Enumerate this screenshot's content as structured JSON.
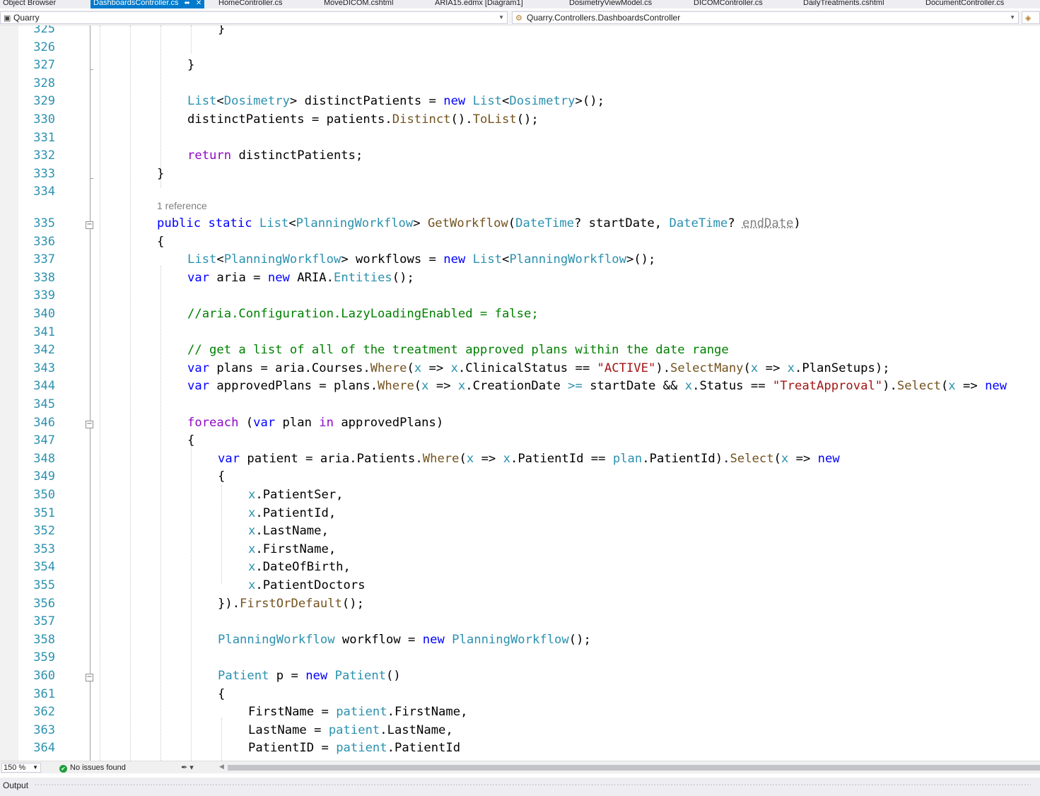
{
  "tabs": [
    {
      "label": "Object Browser",
      "active": false
    },
    {
      "label": "DashboardsController.cs",
      "active": true
    },
    {
      "label": "HomeController.cs",
      "active": false
    },
    {
      "label": "MoveDICOM.cshtml",
      "active": false
    },
    {
      "label": "ARIA15.edmx [Diagram1]",
      "active": false
    },
    {
      "label": "DosimetryViewModel.cs",
      "active": false
    },
    {
      "label": "DICOMController.cs",
      "active": false
    },
    {
      "label": "DailyTreatments.cshtml",
      "active": false
    },
    {
      "label": "DocumentController.cs",
      "active": false
    }
  ],
  "navbar": {
    "project": "Quarry",
    "type_path": "Quarry.Controllers.DashboardsController"
  },
  "editor": {
    "reference_hint": "1 reference",
    "lines": [
      {
        "n": "325"
      },
      {
        "n": "326"
      },
      {
        "n": "327"
      },
      {
        "n": "328"
      },
      {
        "n": "329"
      },
      {
        "n": "330"
      },
      {
        "n": "331"
      },
      {
        "n": "332"
      },
      {
        "n": "333"
      },
      {
        "n": "334"
      },
      {
        "n": "335"
      },
      {
        "n": "336"
      },
      {
        "n": "337"
      },
      {
        "n": "338"
      },
      {
        "n": "339"
      },
      {
        "n": "340"
      },
      {
        "n": "341"
      },
      {
        "n": "342"
      },
      {
        "n": "343"
      },
      {
        "n": "344"
      },
      {
        "n": "345"
      },
      {
        "n": "346"
      },
      {
        "n": "347"
      },
      {
        "n": "348"
      },
      {
        "n": "349"
      },
      {
        "n": "350"
      },
      {
        "n": "351"
      },
      {
        "n": "352"
      },
      {
        "n": "353"
      },
      {
        "n": "354"
      },
      {
        "n": "355"
      },
      {
        "n": "356"
      },
      {
        "n": "357"
      },
      {
        "n": "358"
      },
      {
        "n": "359"
      },
      {
        "n": "360"
      },
      {
        "n": "361"
      },
      {
        "n": "362"
      },
      {
        "n": "363"
      },
      {
        "n": "364"
      }
    ],
    "code": {
      "l325": [
        {
          "c": "op",
          "t": "}"
        }
      ],
      "l327": [
        {
          "c": "op",
          "t": "}"
        }
      ],
      "l329": [
        {
          "c": "ty",
          "t": "List"
        },
        {
          "c": "op",
          "t": "<"
        },
        {
          "c": "ty",
          "t": "Dosimetry"
        },
        {
          "c": "op",
          "t": "> distinctPatients = "
        },
        {
          "c": "kw",
          "t": "new"
        },
        {
          "c": "op",
          "t": " "
        },
        {
          "c": "ty",
          "t": "List"
        },
        {
          "c": "op",
          "t": "<"
        },
        {
          "c": "ty",
          "t": "Dosimetry"
        },
        {
          "c": "op",
          "t": ">();"
        }
      ],
      "l330": [
        {
          "c": "op",
          "t": "distinctPatients = patients."
        },
        {
          "c": "mt",
          "t": "Distinct"
        },
        {
          "c": "op",
          "t": "()."
        },
        {
          "c": "mt",
          "t": "ToList"
        },
        {
          "c": "op",
          "t": "();"
        }
      ],
      "l332": [
        {
          "c": "ctl",
          "t": "return"
        },
        {
          "c": "op",
          "t": " distinctPatients;"
        }
      ],
      "l333": [
        {
          "c": "op",
          "t": "}"
        }
      ],
      "l335": [
        {
          "c": "kw",
          "t": "public"
        },
        {
          "c": "op",
          "t": " "
        },
        {
          "c": "kw",
          "t": "static"
        },
        {
          "c": "op",
          "t": " "
        },
        {
          "c": "ty",
          "t": "List"
        },
        {
          "c": "op",
          "t": "<"
        },
        {
          "c": "ty",
          "t": "PlanningWorkflow"
        },
        {
          "c": "op",
          "t": "> "
        },
        {
          "c": "mt",
          "t": "GetWorkflow"
        },
        {
          "c": "op",
          "t": "("
        },
        {
          "c": "ty",
          "t": "DateTime"
        },
        {
          "c": "op",
          "t": "? startDate, "
        },
        {
          "c": "ty",
          "t": "DateTime"
        },
        {
          "c": "op",
          "t": "? "
        },
        {
          "c": "un",
          "t": "endDate"
        },
        {
          "c": "op",
          "t": ")"
        }
      ],
      "l336": [
        {
          "c": "op",
          "t": "{"
        }
      ],
      "l337": [
        {
          "c": "ty",
          "t": "List"
        },
        {
          "c": "op",
          "t": "<"
        },
        {
          "c": "ty",
          "t": "PlanningWorkflow"
        },
        {
          "c": "op",
          "t": "> workflows = "
        },
        {
          "c": "kw",
          "t": "new"
        },
        {
          "c": "op",
          "t": " "
        },
        {
          "c": "ty",
          "t": "List"
        },
        {
          "c": "op",
          "t": "<"
        },
        {
          "c": "ty",
          "t": "PlanningWorkflow"
        },
        {
          "c": "op",
          "t": ">();"
        }
      ],
      "l338": [
        {
          "c": "kw",
          "t": "var"
        },
        {
          "c": "op",
          "t": " aria = "
        },
        {
          "c": "kw",
          "t": "new"
        },
        {
          "c": "op",
          "t": " ARIA."
        },
        {
          "c": "ty",
          "t": "Entities"
        },
        {
          "c": "op",
          "t": "();"
        }
      ],
      "l340": [
        {
          "c": "cm",
          "t": "//aria.Configuration.LazyLoadingEnabled = false;"
        }
      ],
      "l342": [
        {
          "c": "cm",
          "t": "// get a list of all of the treatment approved plans within the date range"
        }
      ],
      "l343": [
        {
          "c": "kw",
          "t": "var"
        },
        {
          "c": "op",
          "t": " plans = aria.Courses."
        },
        {
          "c": "mt",
          "t": "Where"
        },
        {
          "c": "op",
          "t": "("
        },
        {
          "c": "ty",
          "t": "x"
        },
        {
          "c": "op",
          "t": " => "
        },
        {
          "c": "ty",
          "t": "x"
        },
        {
          "c": "op",
          "t": ".ClinicalStatus == "
        },
        {
          "c": "st",
          "t": "\"ACTIVE\""
        },
        {
          "c": "op",
          "t": ")."
        },
        {
          "c": "mt",
          "t": "SelectMany"
        },
        {
          "c": "op",
          "t": "("
        },
        {
          "c": "ty",
          "t": "x"
        },
        {
          "c": "op",
          "t": " => "
        },
        {
          "c": "ty",
          "t": "x"
        },
        {
          "c": "op",
          "t": ".PlanSetups);"
        }
      ],
      "l344": [
        {
          "c": "kw",
          "t": "var"
        },
        {
          "c": "op",
          "t": " approvedPlans = plans."
        },
        {
          "c": "mt",
          "t": "Where"
        },
        {
          "c": "op",
          "t": "("
        },
        {
          "c": "ty",
          "t": "x"
        },
        {
          "c": "op",
          "t": " => "
        },
        {
          "c": "ty",
          "t": "x"
        },
        {
          "c": "op",
          "t": ".CreationDate "
        },
        {
          "c": "ty",
          "t": ">="
        },
        {
          "c": "op",
          "t": " startDate && "
        },
        {
          "c": "ty",
          "t": "x"
        },
        {
          "c": "op",
          "t": ".Status == "
        },
        {
          "c": "st",
          "t": "\"TreatApproval\""
        },
        {
          "c": "op",
          "t": ")."
        },
        {
          "c": "mt",
          "t": "Select"
        },
        {
          "c": "op",
          "t": "("
        },
        {
          "c": "ty",
          "t": "x"
        },
        {
          "c": "op",
          "t": " => "
        },
        {
          "c": "kw",
          "t": "new"
        }
      ],
      "l346": [
        {
          "c": "ctl",
          "t": "foreach"
        },
        {
          "c": "op",
          "t": " ("
        },
        {
          "c": "kw",
          "t": "var"
        },
        {
          "c": "op",
          "t": " plan "
        },
        {
          "c": "ctl",
          "t": "in"
        },
        {
          "c": "op",
          "t": " approvedPlans)"
        }
      ],
      "l347": [
        {
          "c": "op",
          "t": "{"
        }
      ],
      "l348": [
        {
          "c": "kw",
          "t": "var"
        },
        {
          "c": "op",
          "t": " patient = aria.Patients."
        },
        {
          "c": "mt",
          "t": "Where"
        },
        {
          "c": "op",
          "t": "("
        },
        {
          "c": "ty",
          "t": "x"
        },
        {
          "c": "op",
          "t": " => "
        },
        {
          "c": "ty",
          "t": "x"
        },
        {
          "c": "op",
          "t": ".PatientId == "
        },
        {
          "c": "ty",
          "t": "plan"
        },
        {
          "c": "op",
          "t": ".PatientId)."
        },
        {
          "c": "mt",
          "t": "Select"
        },
        {
          "c": "op",
          "t": "("
        },
        {
          "c": "ty",
          "t": "x"
        },
        {
          "c": "op",
          "t": " => "
        },
        {
          "c": "kw",
          "t": "new"
        }
      ],
      "l349": [
        {
          "c": "op",
          "t": "{"
        }
      ],
      "l350": [
        {
          "c": "ty",
          "t": "x"
        },
        {
          "c": "op",
          "t": ".PatientSer,"
        }
      ],
      "l351": [
        {
          "c": "ty",
          "t": "x"
        },
        {
          "c": "op",
          "t": ".PatientId,"
        }
      ],
      "l352": [
        {
          "c": "ty",
          "t": "x"
        },
        {
          "c": "op",
          "t": ".LastName,"
        }
      ],
      "l353": [
        {
          "c": "ty",
          "t": "x"
        },
        {
          "c": "op",
          "t": ".FirstName,"
        }
      ],
      "l354": [
        {
          "c": "ty",
          "t": "x"
        },
        {
          "c": "op",
          "t": ".DateOfBirth,"
        }
      ],
      "l355": [
        {
          "c": "ty",
          "t": "x"
        },
        {
          "c": "op",
          "t": ".PatientDoctors"
        }
      ],
      "l356": [
        {
          "c": "op",
          "t": "})."
        },
        {
          "c": "mt",
          "t": "FirstOrDefault"
        },
        {
          "c": "op",
          "t": "();"
        }
      ],
      "l358": [
        {
          "c": "ty",
          "t": "PlanningWorkflow"
        },
        {
          "c": "op",
          "t": " workflow = "
        },
        {
          "c": "kw",
          "t": "new"
        },
        {
          "c": "op",
          "t": " "
        },
        {
          "c": "ty",
          "t": "PlanningWorkflow"
        },
        {
          "c": "op",
          "t": "();"
        }
      ],
      "l360": [
        {
          "c": "ty",
          "t": "Patient"
        },
        {
          "c": "op",
          "t": " p = "
        },
        {
          "c": "kw",
          "t": "new"
        },
        {
          "c": "op",
          "t": " "
        },
        {
          "c": "ty",
          "t": "Patient"
        },
        {
          "c": "op",
          "t": "()"
        }
      ],
      "l361": [
        {
          "c": "op",
          "t": "{"
        }
      ],
      "l362": [
        {
          "c": "op",
          "t": "FirstName = "
        },
        {
          "c": "ty",
          "t": "patient"
        },
        {
          "c": "op",
          "t": ".FirstName,"
        }
      ],
      "l363": [
        {
          "c": "op",
          "t": "LastName = "
        },
        {
          "c": "ty",
          "t": "patient"
        },
        {
          "c": "op",
          "t": ".LastName,"
        }
      ],
      "l364": [
        {
          "c": "op",
          "t": "PatientID = "
        },
        {
          "c": "ty",
          "t": "patient"
        },
        {
          "c": "op",
          "t": ".PatientId"
        }
      ]
    }
  },
  "status": {
    "zoom": "150 %",
    "issues": "No issues found"
  },
  "output_panel": {
    "title": "Output"
  },
  "colors": {
    "accent": "#007acc",
    "keyword": "#0000ff",
    "control": "#8f08c4",
    "type": "#2b91af",
    "method": "#74531f",
    "string": "#a31515",
    "comment": "#008000",
    "line_number": "#2b91af"
  },
  "icons": {
    "tab_pin": "pin-icon",
    "tab_close": "close-icon",
    "project": "project-icon",
    "class": "class-icon",
    "issues_ok": "check-circle-icon",
    "cleanup": "brush-icon"
  }
}
